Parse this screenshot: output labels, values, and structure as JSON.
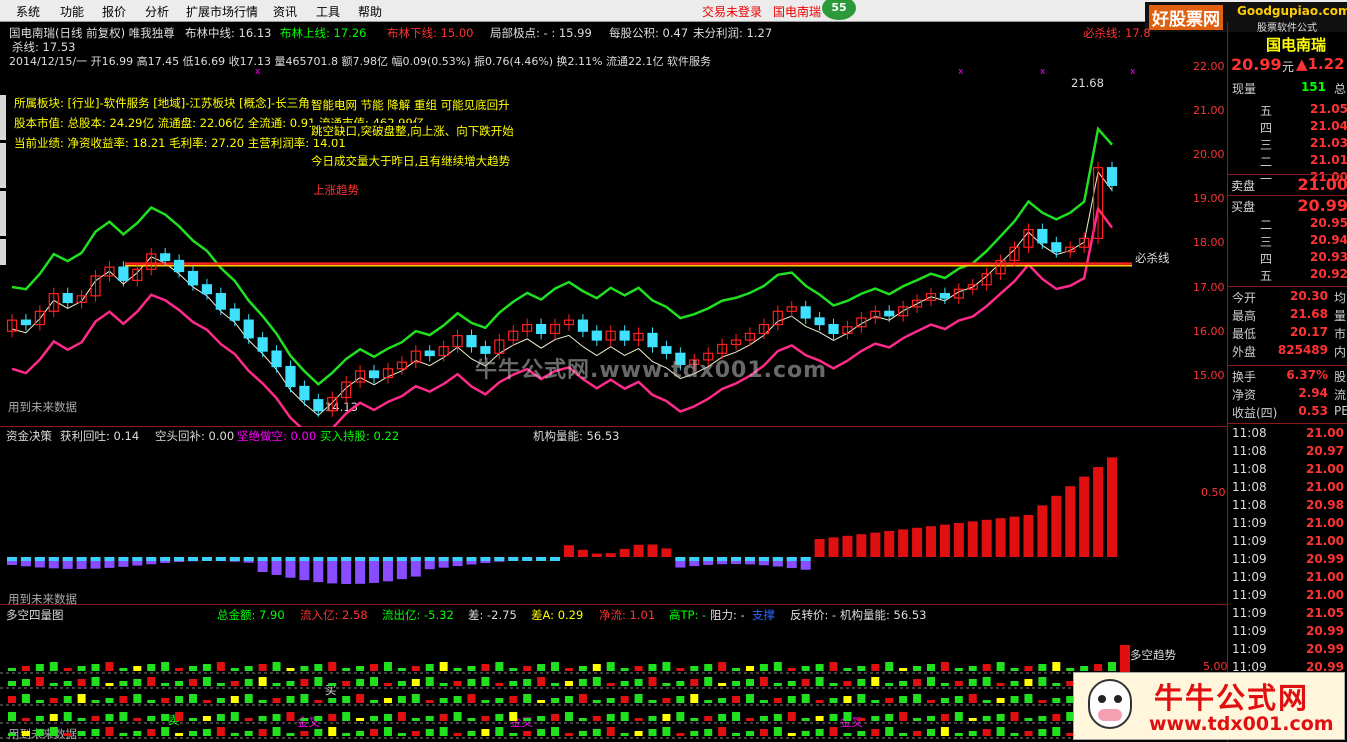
{
  "menu": {
    "items": [
      "系统",
      "功能",
      "报价",
      "分析",
      "扩展市场行情",
      "资讯",
      "工具",
      "帮助"
    ],
    "status": "交易未登录",
    "stock_short": "国电南瑞",
    "badge": "55"
  },
  "top_logo": {
    "site": "好股票网",
    "url": "Goodgupiao.com",
    "app": "股票软件公式"
  },
  "main_panel": {
    "title": "国电南瑞(日线 前复权) 唯我独尊",
    "bb_mid": "布林中线: 16.13",
    "bb_up": "布林上线: 17.26",
    "bb_dn": "布林下线: 15.00",
    "local": "局部极点: -  : 15.99",
    "eps": "每股公积: 0.47",
    "undist": "未分利润: 1.27",
    "sha_line": "杀线: 17.53",
    "ohlc": "2014/12/15/一 开16.99 高17.45 低16.69 收17.13 量465701.8 额7.98亿 幅0.09(0.53%) 振0.76(4.46%) 换2.11% 流通22.1亿 软件服务",
    "bisha_top": "必杀线: 17.8",
    "info1": "所属板块: [行业]-软件服务 [地域]-江苏板块 [概念]-长三角 智能电网 节能减排 稀土 ...",
    "info2": "股本市值: 总股本: 24.29亿 流通盘: 22.06亿 全流通: 0.91 流通市值: 462.99亿",
    "info3": "当前业绩: 净资收益率: 18.21 毛利率: 27.20 主营利润率: 14.01",
    "sig1": "智能电网 节能 降解 重组 可能见底回升",
    "sig2": "跳空缺口,突破盘整,向上涨、向下跌开始",
    "sig3": "今日成交量大于昨日,且有继续增大趋势",
    "trend": "上涨趋势",
    "high_mark": "21.68",
    "low_mark": "14.13",
    "bisha_label": "必杀线",
    "future": "用到未来数据",
    "watermark": "牛牛公式网.www.tdx001.com",
    "price_axis": [
      "22.00",
      "21.00",
      "20.00",
      "19.00",
      "18.00",
      "17.00",
      "16.00",
      "15.00"
    ]
  },
  "mid_panel": {
    "title": "资金决策",
    "a": "获利回吐: 0.14",
    "b": "空头回补: 0.00",
    "c": "坚绝做空: 0.00",
    "d": "买入持股: 0.22",
    "e": "机构量能: 56.53",
    "axis": "0.50",
    "future": "用到未来数据"
  },
  "bot_panel": {
    "title": "多空四量图",
    "a": "总金额: 7.90",
    "b": "流入亿: 2.58",
    "c": "流出亿: -5.32",
    "d": "差: -2.75",
    "e": "差A: 0.29",
    "f": "净流: 1.01",
    "g": "高TP: -",
    "h": "阻力: -",
    "i": "支撑",
    "j": "反转价: -",
    "k": "机构量能: 56.53",
    "trend": "多空趋势",
    "axis": "5.00",
    "buy": "买",
    "sell": "卖",
    "gold": "金叉",
    "future": "用到未来数据"
  },
  "sidebar": {
    "name": "国电南瑞",
    "price": "20.99",
    "unit": "元",
    "change": "▲1.22",
    "cur_vol_label": "现量",
    "cur_vol": "151",
    "total_label": "总",
    "asks": [
      {
        "k": "五",
        "v": "21.05"
      },
      {
        "k": "四",
        "v": "21.04"
      },
      {
        "k": "三",
        "v": "21.03"
      },
      {
        "k": "二",
        "v": "21.01"
      },
      {
        "k": "一",
        "v": "21.00"
      }
    ],
    "sell_label": "卖盘",
    "sell_price": "21.00",
    "buy_label": "买盘",
    "buy_price": "20.99",
    "bids": [
      {
        "k": "二",
        "v": "20.95"
      },
      {
        "k": "三",
        "v": "20.94"
      },
      {
        "k": "四",
        "v": "20.93"
      },
      {
        "k": "五",
        "v": "20.92"
      }
    ],
    "stats": [
      {
        "k": "今开",
        "v": "20.30",
        "s": "均"
      },
      {
        "k": "最高",
        "v": "21.68",
        "s": "量"
      },
      {
        "k": "最低",
        "v": "20.17",
        "s": "市"
      },
      {
        "k": "外盘",
        "v": "825489",
        "s": "内"
      }
    ],
    "stats2": [
      {
        "k": "换手",
        "v": "6.37%",
        "s": "股"
      },
      {
        "k": "净资",
        "v": "2.94",
        "s": "流"
      },
      {
        "k": "收益(四)",
        "v": "0.53",
        "s": "PE"
      }
    ],
    "ticks": [
      {
        "t": "11:08",
        "p": "21.00"
      },
      {
        "t": "11:08",
        "p": "20.97"
      },
      {
        "t": "11:08",
        "p": "21.00"
      },
      {
        "t": "11:08",
        "p": "21.00"
      },
      {
        "t": "11:08",
        "p": "20.98"
      },
      {
        "t": "11:09",
        "p": "21.00"
      },
      {
        "t": "11:09",
        "p": "21.00"
      },
      {
        "t": "11:09",
        "p": "20.99"
      },
      {
        "t": "11:09",
        "p": "21.00"
      },
      {
        "t": "11:09",
        "p": "21.00"
      },
      {
        "t": "11:09",
        "p": "21.05"
      },
      {
        "t": "11:09",
        "p": "20.99"
      },
      {
        "t": "11:09",
        "p": "20.99"
      },
      {
        "t": "11:09",
        "p": "20.99"
      },
      {
        "t": "11:09",
        "p": "20.99"
      }
    ]
  },
  "bottom_logo": {
    "title": "牛牛公式网",
    "url": "www.tdx001.com"
  },
  "colors": {
    "up": "#ff2020",
    "down": "#40e0ff",
    "bb_up": "#20e020",
    "bb_dn": "#ff2a8a",
    "ma": "#f0f0d0",
    "bisha": "#ff2020",
    "bisha_yellow": "#ffd000"
  }
}
